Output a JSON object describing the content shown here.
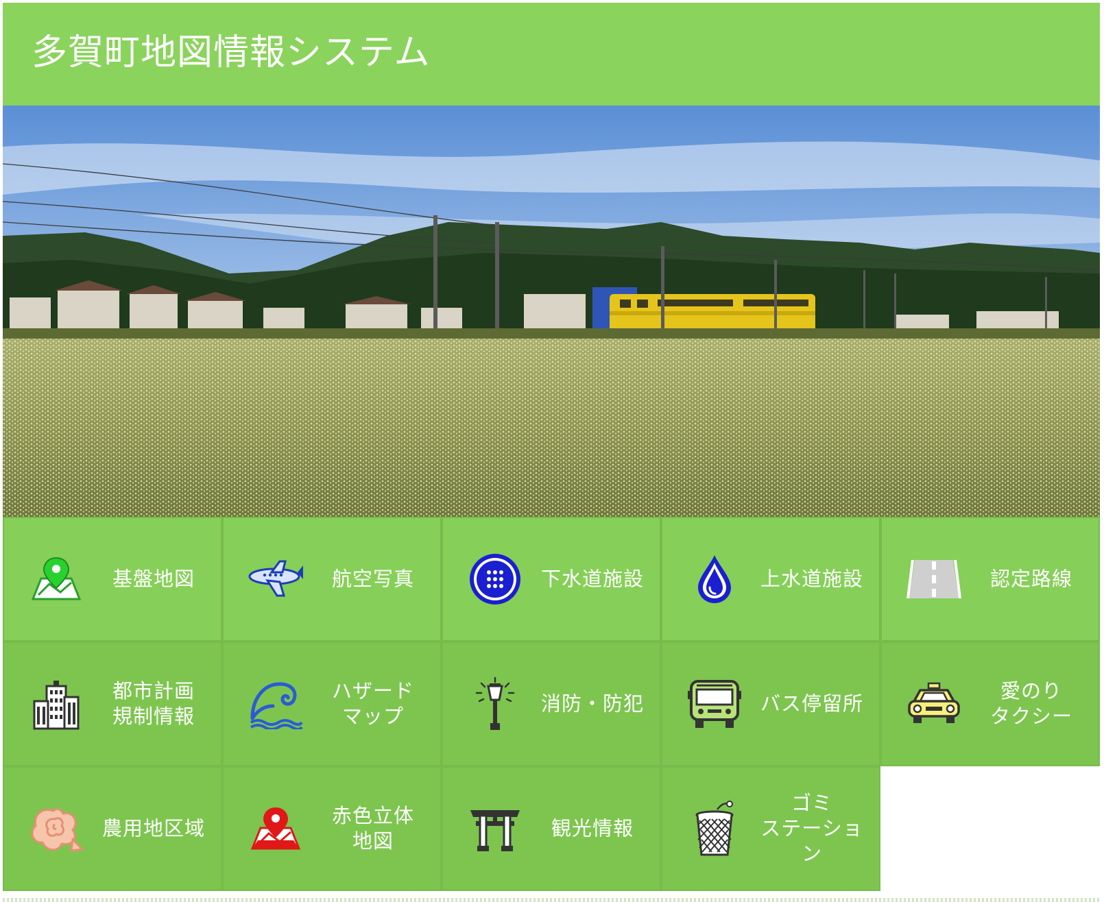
{
  "header": {
    "title": "多賀町地図情報システム"
  },
  "tiles": [
    {
      "label": "基盤地図",
      "icon": "map-pin-icon"
    },
    {
      "label": "航空写真",
      "icon": "airplane-icon"
    },
    {
      "label": "下水道施設",
      "icon": "manhole-icon"
    },
    {
      "label": "上水道施設",
      "icon": "water-drop-icon"
    },
    {
      "label": "認定路線",
      "icon": "road-icon"
    },
    {
      "label": "都市計画\n規制情報",
      "icon": "building-icon"
    },
    {
      "label": "ハザード\nマップ",
      "icon": "wave-icon"
    },
    {
      "label": "消防・防犯",
      "icon": "street-lamp-icon"
    },
    {
      "label": "バス停留所",
      "icon": "bus-icon"
    },
    {
      "label": "愛のり\nタクシー",
      "icon": "taxi-icon"
    },
    {
      "label": "農用地区域",
      "icon": "flower-icon"
    },
    {
      "label": "赤色立体\n地図",
      "icon": "red-map-pin-icon"
    },
    {
      "label": "観光情報",
      "icon": "torii-icon"
    },
    {
      "label": "ゴミ\nステーション",
      "icon": "trash-bin-icon"
    }
  ],
  "colors": {
    "header_bg": "#8ad35c",
    "tile_bg": "#86cf58",
    "tile_border": "#76bb4b",
    "text": "#ffffff"
  }
}
